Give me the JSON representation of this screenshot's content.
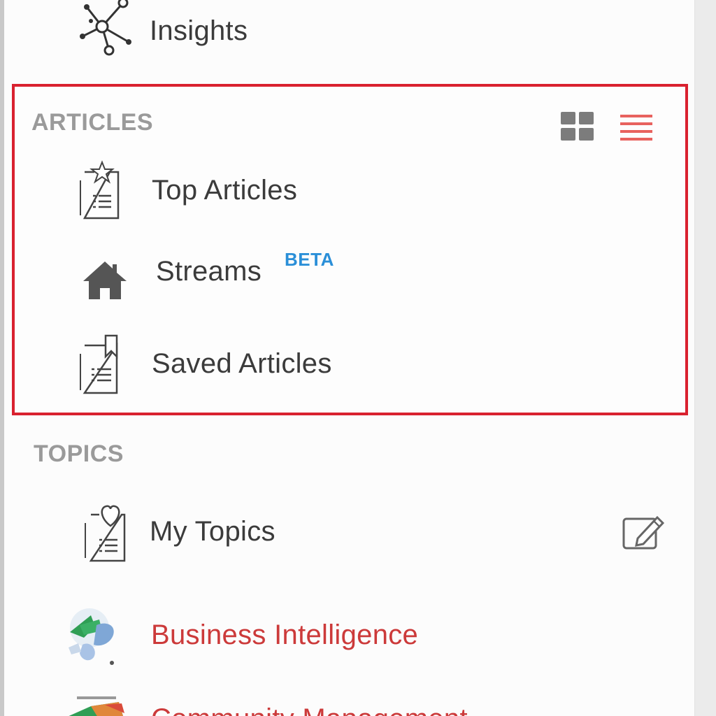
{
  "sidebar": {
    "insights": {
      "label": "Insights",
      "icon": "network-nodes-icon"
    },
    "articles": {
      "title": "ARTICLES",
      "view_toggle": {
        "grid_icon": "grid-view-icon",
        "list_icon": "list-view-icon",
        "active": "list",
        "active_color": "#e8625e"
      },
      "items": [
        {
          "label": "Top Articles",
          "icon": "document-star-icon"
        },
        {
          "label": "Streams",
          "badge": "BETA",
          "icon": "home-icon"
        },
        {
          "label": "Saved Articles",
          "icon": "document-bookmark-icon"
        }
      ]
    },
    "topics": {
      "title": "TOPICS",
      "items": [
        {
          "label": "My Topics",
          "icon": "document-heart-icon",
          "action_icon": "edit-icon"
        },
        {
          "label": "Business Intelligence",
          "icon": "business-intelligence-topic-icon"
        },
        {
          "label": "Community Management",
          "icon": "community-management-topic-icon"
        }
      ]
    }
  },
  "colors": {
    "highlight_border": "#d9212f",
    "beta_badge": "#2a8fd8",
    "topic_link": "#cc3a3a",
    "section_title": "#9a9a9a"
  }
}
